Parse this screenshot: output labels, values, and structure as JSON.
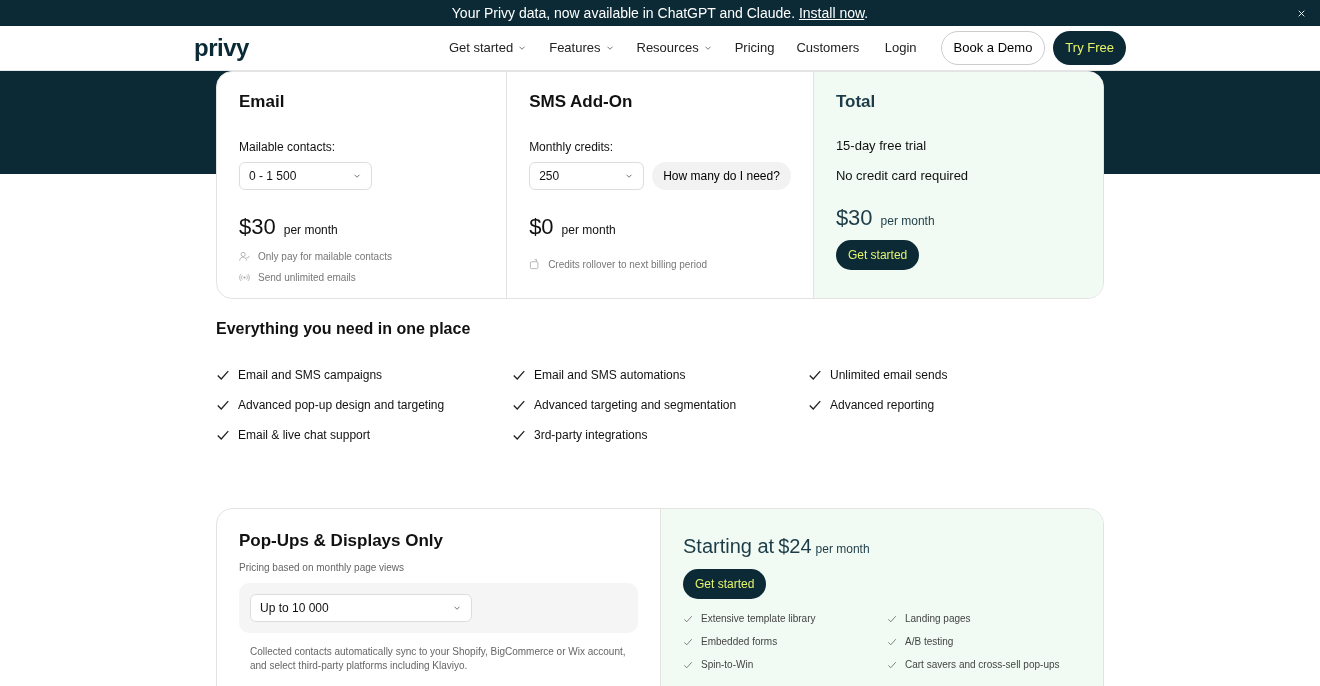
{
  "banner": {
    "text": "Your Privy data, now available in ChatGPT and Claude.",
    "link": "Install now",
    "end": "."
  },
  "nav": {
    "logo": "privy",
    "menu": [
      {
        "label": "Get started",
        "dropdown": true
      },
      {
        "label": "Features",
        "dropdown": true
      },
      {
        "label": "Resources",
        "dropdown": true
      },
      {
        "label": "Pricing",
        "dropdown": false
      },
      {
        "label": "Customers",
        "dropdown": false
      }
    ],
    "login": "Login",
    "demo": "Book a Demo",
    "try": "Try Free"
  },
  "pricing": [
    {
      "kind": "plan",
      "title": "Email",
      "field_label": "Mailable contacts:",
      "select": "0 - 1 500",
      "price": "$30",
      "period": "per month",
      "notes": [
        "Only pay for mailable contacts",
        "Send unlimited emails"
      ]
    },
    {
      "kind": "plan",
      "title": "SMS Add-On",
      "field_label": "Monthly credits:",
      "select": "250",
      "help": "How many do I need?",
      "price": "$0",
      "period": "per month",
      "notes": [
        "Credits rollover to next billing period"
      ]
    },
    {
      "kind": "total",
      "title": "Total",
      "lines": [
        "15-day free trial",
        "No credit card required"
      ],
      "price": "$30",
      "period": "per month",
      "button": "Get started"
    }
  ],
  "features": {
    "title": "Everything you need in one place",
    "items": [
      [
        "Email and SMS campaigns",
        "Advanced pop-up design and targeting",
        "Email & live chat support"
      ],
      [
        "Email and SMS automations",
        "Advanced targeting and segmentation",
        "3rd-party integrations"
      ],
      [
        "Unlimited email sends",
        "Advanced reporting"
      ]
    ]
  },
  "popups": {
    "title": "Pop-Ups & Displays Only",
    "subtitle": "Pricing based on monthly page views",
    "select": "Up to 10 000",
    "note": "Collected contacts automatically sync to your Shopify, BigCommerce or Wix account, and select third-party platforms including Klaviyo.",
    "price_prefix": "Starting at",
    "price": "$24",
    "period": "per month",
    "button": "Get started",
    "items": [
      "Extensive template library",
      "Landing pages",
      "Embedded forms",
      "A/B testing",
      "Spin-to-Win",
      "Cart savers and cross-sell pop-ups"
    ]
  }
}
